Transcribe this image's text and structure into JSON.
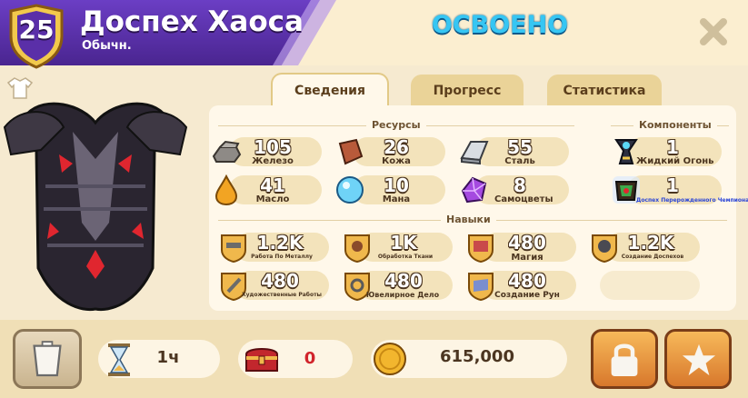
{
  "header": {
    "level": "25",
    "title": "Доспех Хаоса",
    "subtitle": "Обычн.",
    "status": "ОСВОЕНО"
  },
  "tabs": [
    {
      "label": "Сведения",
      "active": true
    },
    {
      "label": "Прогресс",
      "active": false
    },
    {
      "label": "Статистика",
      "active": false
    }
  ],
  "sections": {
    "resources": "Ресурсы",
    "components": "Компоненты",
    "skills": "Навыки"
  },
  "resources": [
    {
      "icon": "iron-icon",
      "value": "105",
      "label": "Железо"
    },
    {
      "icon": "leather-icon",
      "value": "26",
      "label": "Кожа"
    },
    {
      "icon": "steel-icon",
      "value": "55",
      "label": "Сталь"
    },
    {
      "icon": "oil-icon",
      "value": "41",
      "label": "Масло"
    },
    {
      "icon": "mana-icon",
      "value": "10",
      "label": "Мана"
    },
    {
      "icon": "gems-icon",
      "value": "8",
      "label": "Самоцветы"
    }
  ],
  "components": [
    {
      "icon": "liquid-fire-icon",
      "value": "1",
      "label": "Жидкий Огонь"
    },
    {
      "icon": "tainted-armor-icon",
      "value": "1",
      "label": "Доспех Перерожденного Чемпиона"
    }
  ],
  "skills": [
    {
      "icon": "metalwork-skill-icon",
      "value": "1.2K",
      "label": "Работа По Металлу"
    },
    {
      "icon": "textile-skill-icon",
      "value": "1K",
      "label": "Обработка Ткани"
    },
    {
      "icon": "magic-skill-icon",
      "value": "480",
      "label": "Магия"
    },
    {
      "icon": "armor-crafting-skill-icon",
      "value": "1.2K",
      "label": "Создание Доспехов"
    },
    {
      "icon": "art-skill-icon",
      "value": "480",
      "label": "Художественные Работы"
    },
    {
      "icon": "jewelry-skill-icon",
      "value": "480",
      "label": "Ювелирное Дело"
    },
    {
      "icon": "rune-skill-icon",
      "value": "480",
      "label": "Создание Рун"
    }
  ],
  "footer": {
    "craft_time": "1ч",
    "chest_count": "0",
    "price": "615,000"
  },
  "colors": {
    "header_purple": "#5a2fa8",
    "mastered_blue": "#36c6f3",
    "accent_orange": "#e89a3c",
    "chest_red": "#c2272d"
  }
}
